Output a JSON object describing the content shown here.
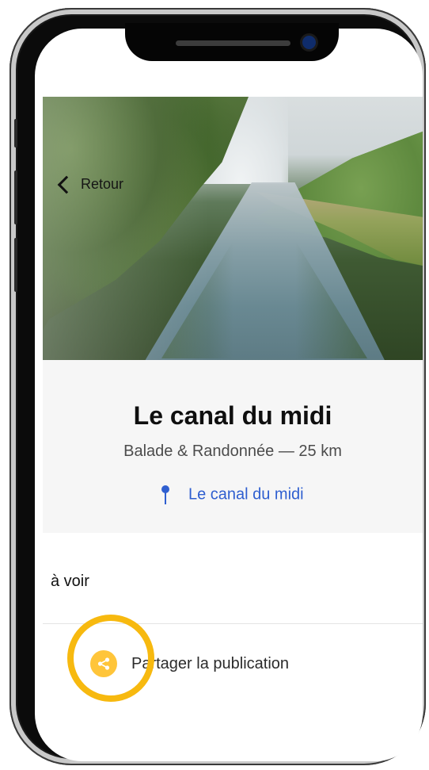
{
  "header": {
    "back_label": "Retour"
  },
  "place": {
    "title": "Le canal du midi",
    "subtitle": "Balade & Randonnée — 25 km",
    "location_label": "Le canal du midi"
  },
  "sections": {
    "to_see_label": "à voir"
  },
  "share": {
    "label": "Partager la publication"
  },
  "colors": {
    "link_blue": "#2f5fd0",
    "share_yellow": "#ffc53a",
    "highlight_ring": "#f7b90f"
  },
  "icons": {
    "back": "chevron-left-icon",
    "location": "pin-icon",
    "share": "share-icon"
  }
}
